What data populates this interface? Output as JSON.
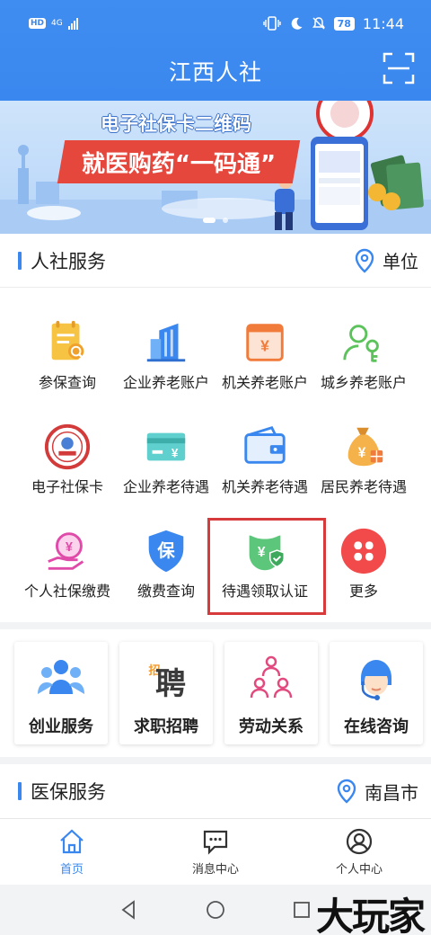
{
  "status": {
    "network": "4G",
    "hd": "HD",
    "battery": "78",
    "time": "11:44"
  },
  "header": {
    "title": "江西人社"
  },
  "banner": {
    "line1": "电子社保卡二维码",
    "line2": "就医购药“一码通”"
  },
  "services": {
    "title": "人社服务",
    "location": "单位",
    "items": [
      {
        "label": "参保查询",
        "icon": "insurance-query-icon"
      },
      {
        "label": "企业养老账户",
        "icon": "enterprise-pension-account-icon"
      },
      {
        "label": "机关养老账户",
        "icon": "government-pension-account-icon"
      },
      {
        "label": "城乡养老账户",
        "icon": "urban-rural-pension-account-icon"
      },
      {
        "label": "电子社保卡",
        "icon": "social-security-card-icon"
      },
      {
        "label": "企业养老待遇",
        "icon": "enterprise-pension-benefit-icon"
      },
      {
        "label": "机关养老待遇",
        "icon": "government-pension-benefit-icon"
      },
      {
        "label": "居民养老待遇",
        "icon": "resident-pension-benefit-icon"
      },
      {
        "label": "个人社保缴费",
        "icon": "personal-payment-icon"
      },
      {
        "label": "缴费查询",
        "icon": "payment-query-icon"
      },
      {
        "label": "待遇领取认证",
        "icon": "benefit-certification-icon"
      },
      {
        "label": "更多",
        "icon": "more-icon"
      }
    ]
  },
  "tiles": [
    {
      "label": "创业服务",
      "icon": "entrepreneurship-icon"
    },
    {
      "label": "求职招聘",
      "icon": "recruitment-icon"
    },
    {
      "label": "劳动关系",
      "icon": "labor-relations-icon"
    },
    {
      "label": "在线咨询",
      "icon": "online-consult-icon"
    }
  ],
  "medical": {
    "title": "医保服务",
    "location": "南昌市"
  },
  "bottom_nav": [
    {
      "label": "首页",
      "active": true
    },
    {
      "label": "消息中心",
      "active": false
    },
    {
      "label": "个人中心",
      "active": false
    }
  ],
  "watermark": "大玩家",
  "colors": {
    "primary": "#3a88ef",
    "highlight": "#d73a3a"
  }
}
